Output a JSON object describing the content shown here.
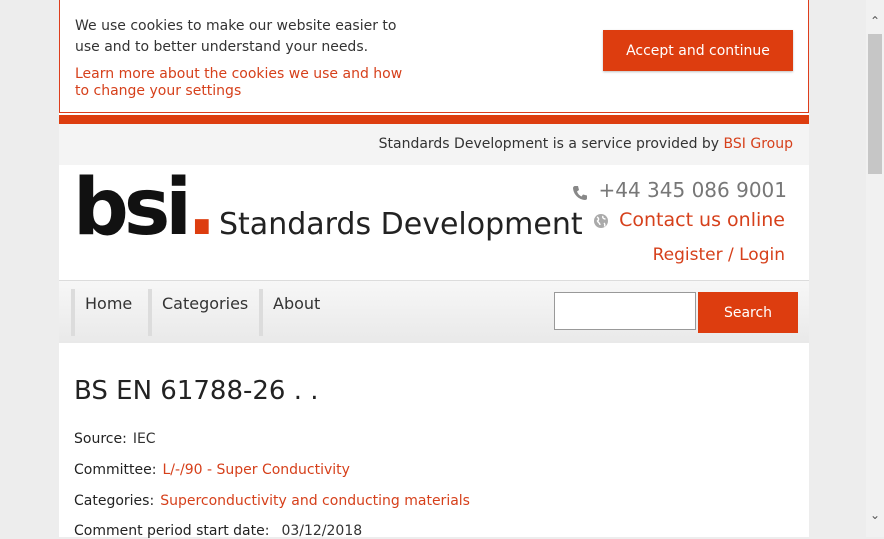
{
  "cookie": {
    "message": "We use cookies to make our website easier to use and to better understand your needs.",
    "link": "Learn more about the cookies we use and how to change your settings",
    "accept_label": "Accept and continue"
  },
  "service": {
    "text": "Standards Development is a service provided by ",
    "link": "BSI Group"
  },
  "header": {
    "logo": "bsi",
    "logo_dot": ".",
    "site_title": "Standards Development",
    "phone": "+44 345 086 9001",
    "contact": "Contact us online",
    "login": "Register / Login"
  },
  "nav": {
    "items": [
      "Home",
      "Categories",
      "About"
    ],
    "search_label": "Search",
    "search_value": ""
  },
  "document": {
    "title": "BS EN 61788-26 . .",
    "source_label": "Source:",
    "source_value": "IEC",
    "committee_label": "Committee:",
    "committee_value": "L/-/90 - Super Conductivity",
    "categories_label": "Categories:",
    "categories_value": "Superconductivity and conducting materials",
    "comment_start_label": "Comment period start date:",
    "comment_start_value": "03/12/2018"
  },
  "colors": {
    "accent": "#dd3d0f",
    "link": "#d6401b"
  }
}
